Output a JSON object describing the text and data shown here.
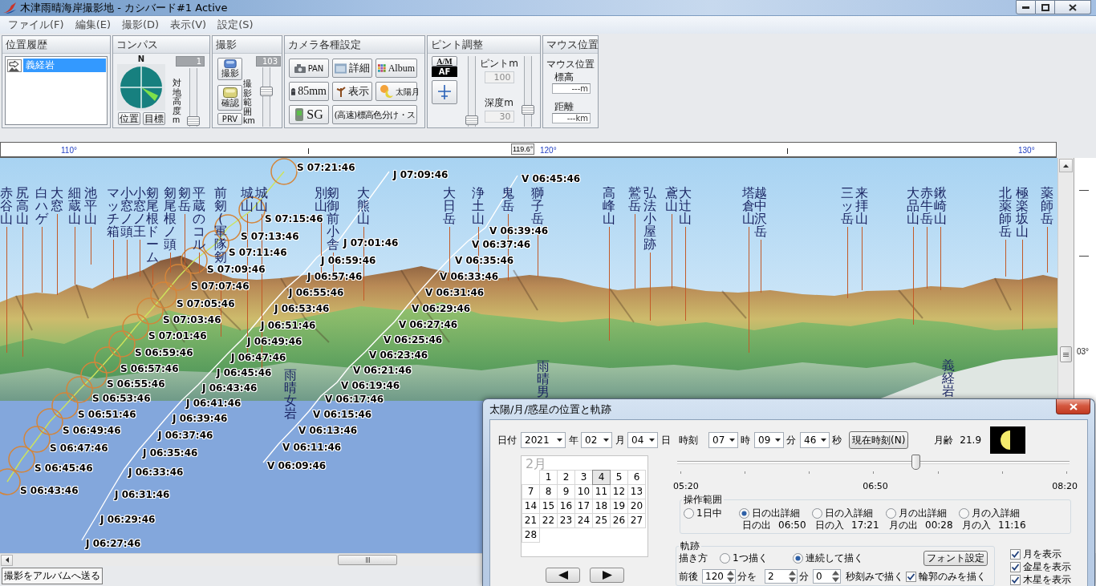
{
  "window": {
    "title": "木津雨晴海岸撮影地 - カシバード#1 Active"
  },
  "menu": [
    "ファイル(F)",
    "編集(E)",
    "撮影(D)",
    "表示(V)",
    "設定(S)"
  ],
  "toolbar": {
    "history": {
      "title": "位置履歴",
      "items": [
        {
          "label": "義経岩",
          "selected": true
        }
      ]
    },
    "compass": {
      "title": "コンパス",
      "north": "N",
      "buttons": [
        "位置",
        "目標"
      ],
      "height_slider": {
        "label": "対地高度m",
        "value": "1",
        "level": 0.02
      }
    },
    "shoot": {
      "title": "撮影",
      "buttons": [
        {
          "label": "撮影",
          "kind": "shoot"
        },
        {
          "label": "確認",
          "kind": "check"
        },
        {
          "label": "PRV",
          "kind": "plain"
        }
      ],
      "range_slider": {
        "label": "撮影範囲km",
        "value": "103",
        "level": 0.62
      }
    },
    "camera": {
      "title": "カメラ各種設定",
      "buttons": [
        {
          "label": "PAN",
          "kind": "pan"
        },
        {
          "label": "詳細",
          "kind": "detail"
        },
        {
          "label": "Album",
          "kind": "album"
        },
        {
          "label": "85mm",
          "kind": "lens"
        },
        {
          "label": "表示",
          "kind": "display"
        },
        {
          "label": "太陽月",
          "kind": "sun"
        },
        {
          "label": "SG",
          "kind": "sg"
        },
        {
          "label": "(高速)標高色分け・ス",
          "kind": "wide"
        }
      ]
    },
    "focus": {
      "title": "ピント調整",
      "mode_button": "A/M",
      "mode_value": "AF",
      "focus": {
        "label": "ピントm",
        "value": "100",
        "level": 0.02
      },
      "depth": {
        "label": "深度m",
        "value": "30",
        "level": 0.2
      }
    },
    "mouse": {
      "title": "マウス位置",
      "heading": "マウス位置",
      "elevation_label": "標高",
      "elevation_value": "---m",
      "distance_label": "距離",
      "distance_value": "---km"
    }
  },
  "ruler": {
    "labels": [
      "110°",
      "120°",
      "130°"
    ],
    "marker": "119.6°"
  },
  "panorama": {
    "peaks": [
      "赤谷山",
      "尻高山",
      "白ハゲ",
      "大窓",
      "細蔵山",
      "池平山",
      "マッチ箱",
      "小窓ノ頭",
      "小窓ノ王",
      "剱尾根ドーム",
      "剱尾根ノ頭",
      "剱岳",
      "平蔵のコル",
      "前剱(軍隊剱",
      "城山",
      "城山",
      "別山",
      "剱御前小舎",
      "大熊山",
      "大日岳",
      "浄土山",
      "鬼岳",
      "獅子岳",
      "高峰山",
      "鷲岳",
      "弘法小屋跡",
      "鳶山",
      "大辻山",
      "塔倉山",
      "越中沢岳",
      "三ッ岳",
      "来拝山",
      "大品山",
      "赤牛岳",
      "鍬崎山",
      "北薬師岳",
      "極楽坂山",
      "薬師岳"
    ],
    "landmarks": [
      "雨晴女岩",
      "雨晴男",
      "義経岩"
    ],
    "trails": [
      {
        "kind": "sun",
        "labels": [
          "S 07:21:46",
          "S 07:15:46",
          "S 07:13:46",
          "S 07:11:46",
          "S 07:09:46",
          "S 07:07:46",
          "S 07:05:46",
          "S 07:03:46",
          "S 07:01:46",
          "S 06:59:46",
          "S 06:57:46",
          "S 06:55:46",
          "S 06:53:46",
          "S 06:51:46",
          "S 06:49:46",
          "S 06:47:46",
          "S 06:45:46",
          "S 06:43:46"
        ]
      },
      {
        "kind": "jupiter",
        "labels": [
          "J 07:09:46",
          "J 07:01:46",
          "J 06:59:46",
          "J 06:57:46",
          "J 06:55:46",
          "J 06:53:46",
          "J 06:51:46",
          "J 06:49:46",
          "J 06:47:46",
          "J 06:45:46",
          "J 06:43:46",
          "J 06:41:46",
          "J 06:39:46",
          "J 06:37:46",
          "J 06:35:46",
          "J 06:33:46",
          "J 06:31:46",
          "J 06:29:46",
          "J 06:27:46"
        ]
      },
      {
        "kind": "venus",
        "labels": [
          "V 06:45:46",
          "V 06:39:46",
          "V 06:37:46",
          "V 06:35:46",
          "V 06:33:46",
          "V 06:31:46",
          "V 06:29:46",
          "V 06:27:46",
          "V 06:25:46",
          "V 06:23:46",
          "V 06:21:46",
          "V 06:19:46",
          "V 06:17:46",
          "V 06:15:46",
          "V 06:13:46",
          "V 06:11:46",
          "V 06:09:46"
        ]
      }
    ],
    "scale_label": "03°"
  },
  "status": {
    "button": "撮影をアルバムへ送る"
  },
  "dialog": {
    "title": "太陽/月/惑星の位置と軌跡",
    "date_label": "日付",
    "date": [
      {
        "value": "2021",
        "unit": "年"
      },
      {
        "value": "02",
        "unit": "月"
      },
      {
        "value": "04",
        "unit": "日"
      }
    ],
    "time_label": "時刻",
    "time": [
      {
        "value": "07",
        "unit": "時"
      },
      {
        "value": "09",
        "unit": "分"
      },
      {
        "value": "46",
        "unit": "秒"
      }
    ],
    "now_button": "現在時刻(N)",
    "moon_age_label": "月齢",
    "moon_age": "21.9",
    "calendar": {
      "month": "2月",
      "days": [
        {
          "label": "1",
          "selected": false
        },
        {
          "label": "2",
          "selected": false
        },
        {
          "label": "3",
          "selected": false
        },
        {
          "label": "4",
          "selected": true
        },
        {
          "label": "5",
          "selected": false
        },
        {
          "label": "6",
          "selected": false
        },
        {
          "label": "7",
          "selected": false
        },
        {
          "label": "8",
          "selected": false
        },
        {
          "label": "9",
          "selected": false
        },
        {
          "label": "10",
          "selected": false
        },
        {
          "label": "11",
          "selected": false
        },
        {
          "label": "12",
          "selected": false
        },
        {
          "label": "13",
          "selected": false
        },
        {
          "label": "14",
          "selected": false
        },
        {
          "label": "15",
          "selected": false
        },
        {
          "label": "16",
          "selected": false
        },
        {
          "label": "17",
          "selected": false
        },
        {
          "label": "18",
          "selected": false
        },
        {
          "label": "19",
          "selected": false
        },
        {
          "label": "20",
          "selected": false
        },
        {
          "label": "21",
          "selected": false
        },
        {
          "label": "22",
          "selected": false
        },
        {
          "label": "23",
          "selected": false
        },
        {
          "label": "24",
          "selected": false
        },
        {
          "label": "25",
          "selected": false
        },
        {
          "label": "26",
          "selected": false
        },
        {
          "label": "27",
          "selected": false
        },
        {
          "label": "28",
          "selected": false
        }
      ]
    },
    "time_slider": {
      "level": 0.61,
      "labels": [
        "05:20",
        "06:50",
        "08:20"
      ]
    },
    "range": {
      "title": "操作範囲",
      "options": [
        {
          "label": "1日中",
          "selected": false
        },
        {
          "label": "日の出詳細",
          "selected": true,
          "event": "日の出",
          "time": "06:50"
        },
        {
          "label": "日の入詳細",
          "selected": false,
          "event": "日の入",
          "time": "17:21"
        },
        {
          "label": "月の出詳細",
          "selected": false,
          "event": "月の出",
          "time": "00:28"
        },
        {
          "label": "月の入詳細",
          "selected": false,
          "event": "月の入",
          "time": "11:16"
        }
      ]
    },
    "trail": {
      "title": "軌跡",
      "mode_label": "描き方",
      "modes": [
        {
          "label": "1つ描く",
          "selected": false
        },
        {
          "label": "連続して描く",
          "selected": true
        }
      ],
      "font_button": "フォント設定",
      "span_label": "前後",
      "span_value": "120",
      "span_unit": "分を",
      "step_minutes": "2",
      "minutes_unit": "分",
      "step_seconds": "0",
      "seconds_unit": "秒刻みで描く",
      "outline": {
        "label": "輪郭のみを描く",
        "checked": true
      }
    },
    "show": [
      {
        "label": "月を表示",
        "checked": true
      },
      {
        "label": "金星を表示",
        "checked": true
      },
      {
        "label": "木星を表示",
        "checked": true
      }
    ]
  }
}
